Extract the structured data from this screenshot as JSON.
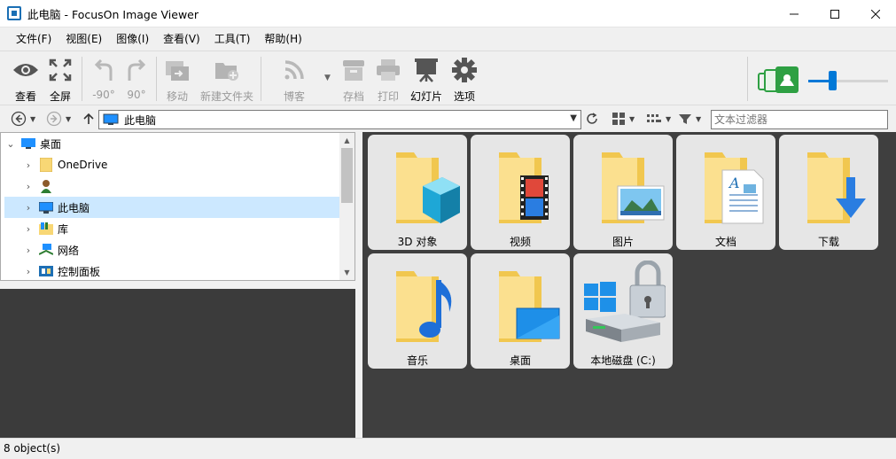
{
  "window": {
    "title": "此电脑 - FocusOn Image Viewer"
  },
  "menu": [
    "文件(F)",
    "视图(E)",
    "图像(I)",
    "查看(V)",
    "工具(T)",
    "帮助(H)"
  ],
  "toolbar": {
    "view": "查看",
    "fullscreen": "全屏",
    "rotate_left": "-90°",
    "rotate_right": "90°",
    "move": "移动",
    "new_folder": "新建文件夹",
    "blog": "博客",
    "archive": "存档",
    "print": "打印",
    "slideshow": "幻灯片",
    "options": "选项"
  },
  "address": {
    "path": "此电脑",
    "filter_placeholder": "文本过滤器"
  },
  "tree": {
    "items": [
      {
        "label": "桌面"
      },
      {
        "label": "OneDrive"
      },
      {
        "label": ""
      },
      {
        "label": "此电脑"
      },
      {
        "label": "库"
      },
      {
        "label": "网络"
      },
      {
        "label": "控制面板"
      }
    ]
  },
  "grid": {
    "items": [
      {
        "label": "3D 对象"
      },
      {
        "label": "视频"
      },
      {
        "label": "图片"
      },
      {
        "label": "文档"
      },
      {
        "label": "下载"
      },
      {
        "label": "音乐"
      },
      {
        "label": "桌面"
      },
      {
        "label": "本地磁盘 (C:)"
      }
    ]
  },
  "status": {
    "text": "8 object(s)"
  },
  "colors": {
    "accent": "#0078d7",
    "selected": "#cce8ff",
    "panel_dark": "#3f3f3f",
    "folder": "#f8d775"
  }
}
